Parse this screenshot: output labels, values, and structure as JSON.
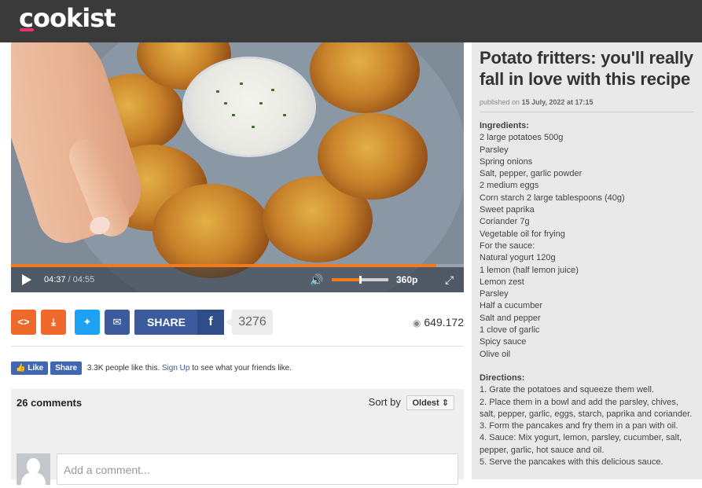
{
  "header": {
    "logo": "cookist"
  },
  "video": {
    "current_time": "04:37",
    "duration": "/ 04:55",
    "progress": 0.94,
    "volume": 0.48,
    "quality": "360p"
  },
  "share": {
    "share_label": "SHARE",
    "fb_letter": "f",
    "share_count": "3276",
    "views": "649.172"
  },
  "facebook": {
    "like_label": "Like",
    "share_label": "Share",
    "text_pre": "3.3K people like this.",
    "signup_label": "Sign Up",
    "text_post": "to see what your friends like."
  },
  "comments": {
    "count_label": "26 comments",
    "sort_label": "Sort by",
    "sort_value": "Oldest",
    "input_placeholder": "Add a comment..."
  },
  "article": {
    "title": "Potato fritters: you'll really fall in love with this recipe",
    "published_prefix": "published on",
    "published_date": "15 July, 2022 at 17:15",
    "ingredients_heading": "Ingredients:",
    "ingredients": [
      "2 large potatoes 500g",
      "Parsley",
      "Spring onions",
      "Salt, pepper, garlic powder",
      "2 medium eggs",
      "Corn starch 2 large tablespoons (40g)",
      "Sweet paprika",
      "Coriander 7g",
      "Vegetable oil for frying",
      "For the sauce:",
      "Natural yogurt 120g",
      "1 lemon (half lemon juice)",
      "Lemon zest",
      "Parsley",
      "Half a cucumber",
      "Salt and pepper",
      "1 clove of garlic",
      "Spicy sauce",
      "Olive oil"
    ],
    "directions_heading": "Directions:",
    "directions": [
      "1. Grate the potatoes and squeeze them well.",
      "2. Place them in a bowl and add the parsley, chives, salt, pepper, garlic, eggs, starch, paprika and coriander.",
      "3. Form the pancakes and fry them in a pan with oil.",
      "4. Sauce: Mix yogurt, lemon, parsley, cucumber, salt, pepper, garlic, hot sauce and oil.",
      "5. Serve the pancakes with this delicious sauce."
    ]
  },
  "colors": {
    "header_bg": "#3a3a3a",
    "accent_orange": "#f07a1e",
    "embed_orange": "#ef6a2a",
    "twitter_blue": "#1da1f2",
    "facebook_blue": "#3b5b9c",
    "sidebar_bg": "#e9e9e9"
  }
}
